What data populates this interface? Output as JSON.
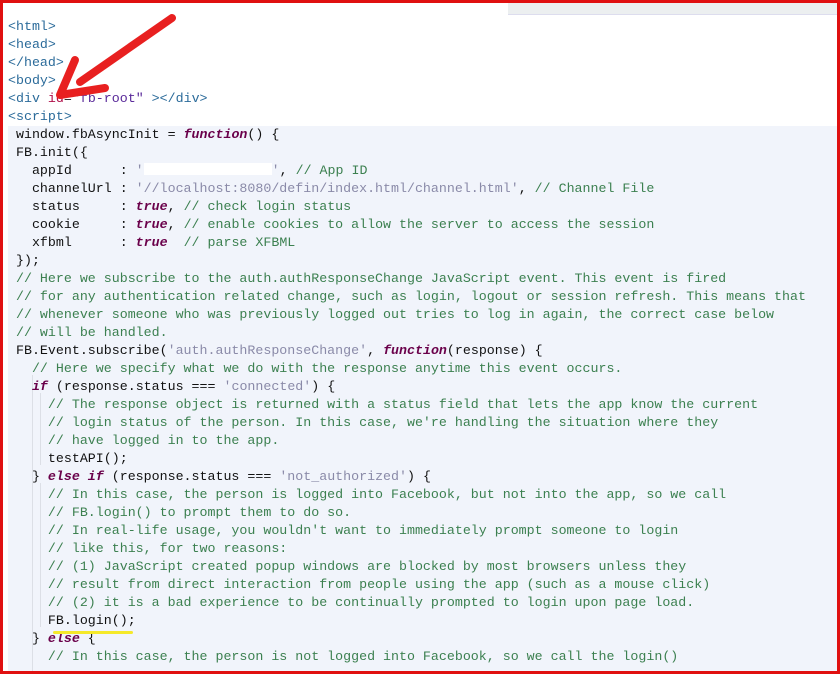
{
  "colors": {
    "frame": "#e01010",
    "arrow": "#e82020",
    "highlight": "#f5e92a",
    "editor_bg": "#f1f4fb"
  },
  "annotations": {
    "arrow": "red-arrow pointing at id attribute",
    "underline": "yellow underline under FB.login();"
  },
  "lines": [
    [
      [
        "<html>",
        "tag"
      ]
    ],
    [
      [
        "<head>",
        "tag"
      ]
    ],
    [
      [
        "</head>",
        "tag"
      ]
    ],
    [
      [
        "<body>",
        "tag"
      ]
    ],
    [
      [
        "<div ",
        "tag"
      ],
      [
        "id",
        "attr"
      ],
      [
        "=",
        "pl"
      ],
      [
        "\"fb-root\"",
        "aval"
      ],
      [
        " ></div>",
        "tag"
      ]
    ],
    [
      [
        "<script>",
        "tag"
      ]
    ],
    [
      [
        " window.fbAsyncInit = ",
        "pl"
      ],
      [
        "function",
        "kw"
      ],
      [
        "() {",
        "pl"
      ]
    ],
    [
      [
        " FB.init({",
        "pl"
      ]
    ],
    [
      [
        "   appId      : ",
        "pl"
      ],
      [
        "'",
        "str"
      ],
      [
        "",
        "redact"
      ],
      [
        "'",
        "str"
      ],
      [
        ", ",
        "pl"
      ],
      [
        "// App ID",
        "cm"
      ]
    ],
    [
      [
        "   channelUrl : ",
        "pl"
      ],
      [
        "'//localhost:8080/defin/index.html/channel.html'",
        "str"
      ],
      [
        ", ",
        "pl"
      ],
      [
        "// Channel File",
        "cm"
      ]
    ],
    [
      [
        "   status     : ",
        "pl"
      ],
      [
        "true",
        "kw"
      ],
      [
        ", ",
        "pl"
      ],
      [
        "// check login status",
        "cm"
      ]
    ],
    [
      [
        "   cookie     : ",
        "pl"
      ],
      [
        "true",
        "kw"
      ],
      [
        ", ",
        "pl"
      ],
      [
        "// enable cookies to allow the server to access the session",
        "cm"
      ]
    ],
    [
      [
        "   xfbml      : ",
        "pl"
      ],
      [
        "true",
        "kw"
      ],
      [
        "  ",
        "pl"
      ],
      [
        "// parse XFBML",
        "cm"
      ]
    ],
    [
      [
        " });",
        "pl"
      ]
    ],
    [
      [
        " // Here we subscribe to the auth.authResponseChange JavaScript event. This event is fired",
        "cm"
      ]
    ],
    [
      [
        " // for any authentication related change, such as login, logout or session refresh. This means that",
        "cm"
      ]
    ],
    [
      [
        " // whenever someone who was previously logged out tries to log in again, the correct case below",
        "cm"
      ]
    ],
    [
      [
        " // will be handled.",
        "cm"
      ]
    ],
    [
      [
        " FB.Event.subscribe(",
        "pl"
      ],
      [
        "'auth.authResponseChange'",
        "str"
      ],
      [
        ", ",
        "pl"
      ],
      [
        "function",
        "kw"
      ],
      [
        "(response) {",
        "pl"
      ]
    ],
    [
      [
        "   // Here we specify what we do with the response anytime this event occurs.",
        "cm"
      ]
    ],
    [
      [
        "   ",
        "pl"
      ],
      [
        "if",
        "kw"
      ],
      [
        " (response.status === ",
        "pl"
      ],
      [
        "'connected'",
        "str"
      ],
      [
        ") {",
        "pl"
      ]
    ],
    [
      [
        "     // The response object is returned with a status field that lets the app know the current",
        "cm"
      ]
    ],
    [
      [
        "     // login status of the person. In this case, we're handling the situation where they",
        "cm"
      ]
    ],
    [
      [
        "     // have logged in to the app.",
        "cm"
      ]
    ],
    [
      [
        "     testAPI();",
        "pl"
      ]
    ],
    [
      [
        "   } ",
        "pl"
      ],
      [
        "else if",
        "kw"
      ],
      [
        " (response.status === ",
        "pl"
      ],
      [
        "'not_authorized'",
        "str"
      ],
      [
        ") {",
        "pl"
      ]
    ],
    [
      [
        "     // In this case, the person is logged into Facebook, but not into the app, so we call",
        "cm"
      ]
    ],
    [
      [
        "     // FB.login() to prompt them to do so.",
        "cm"
      ]
    ],
    [
      [
        "     // In real-life usage, you wouldn't want to immediately prompt someone to login",
        "cm"
      ]
    ],
    [
      [
        "     // like this, for two reasons:",
        "cm"
      ]
    ],
    [
      [
        "     // (1) JavaScript created popup windows are blocked by most browsers unless they",
        "cm"
      ]
    ],
    [
      [
        "     // result from direct interaction from people using the app (such as a mouse click)",
        "cm"
      ]
    ],
    [
      [
        "     // (2) it is a bad experience to be continually prompted to login upon page load.",
        "cm"
      ]
    ],
    [
      [
        "     FB.login();",
        "pl"
      ]
    ],
    [
      [
        "   } ",
        "pl"
      ],
      [
        "else",
        "kw"
      ],
      [
        " {",
        "pl"
      ]
    ],
    [
      [
        "     // In this case, the person is not logged into Facebook, so we call the login()",
        "cm"
      ]
    ]
  ]
}
